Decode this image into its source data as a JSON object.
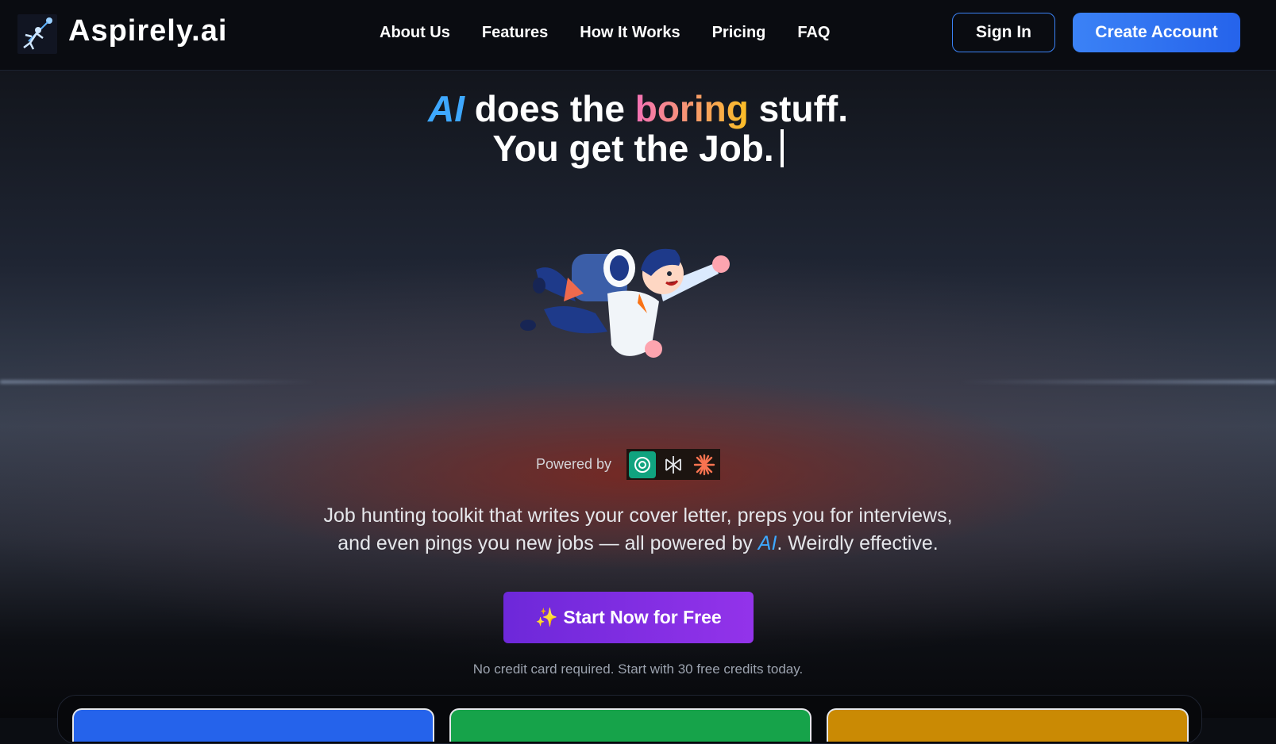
{
  "header": {
    "brand": "Aspirely.ai",
    "logo_icon": "rocket-person-icon",
    "nav": [
      {
        "label": "About Us"
      },
      {
        "label": "Features"
      },
      {
        "label": "How It Works"
      },
      {
        "label": "Pricing"
      },
      {
        "label": "FAQ"
      }
    ],
    "sign_in": "Sign In",
    "create_account": "Create Account"
  },
  "hero": {
    "headline_ai": "AI",
    "headline_part1": "does the",
    "headline_boring": "boring",
    "headline_part2": "stuff.",
    "headline_line2": "You get the Job.",
    "mascot_icon": "jetpack-person-illustration",
    "powered_by": "Powered by",
    "providers": [
      "openai-icon",
      "perplexity-icon",
      "anthropic-icon"
    ],
    "desc_line1": "Job hunting toolkit that writes your cover letter, preps you for interviews,",
    "desc_line2_a": "and even pings you new jobs — all powered by",
    "desc_ai": "AI",
    "desc_line2_b": ". Weirdly effective.",
    "cta_icon": "sparkles-icon",
    "cta_label": "Start Now for Free",
    "note": "No credit card required. Start with 30 free credits today."
  },
  "colors": {
    "accent_blue": "#3b82f6",
    "cta_purple": "#7c3aed",
    "card_blue": "#2563eb",
    "card_green": "#16a34a",
    "card_yellow": "#ca8a04"
  }
}
